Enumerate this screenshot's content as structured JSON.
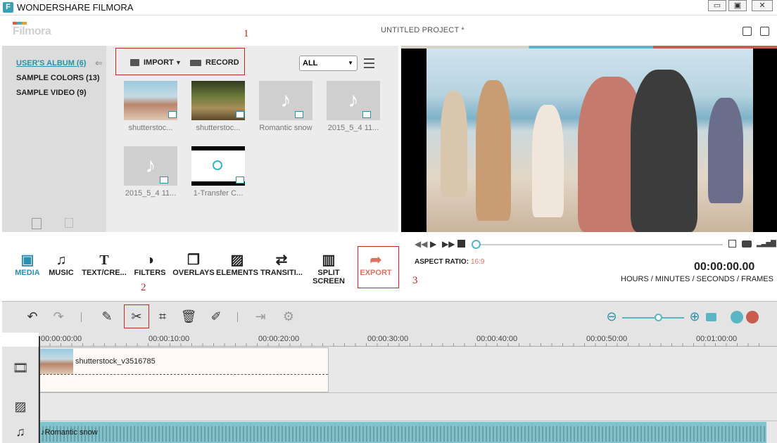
{
  "window": {
    "title": "WONDERSHARE FILMORA",
    "app_icon": "F",
    "minimize": "▭",
    "maximize": "▣",
    "close": "✕"
  },
  "header": {
    "logo": "Filmora",
    "project_title": "UNTITLED PROJECT *"
  },
  "annotations": {
    "one": "1",
    "two": "2",
    "three": "3"
  },
  "library": {
    "albums": [
      "USER'S ALBUM (6)",
      "SAMPLE COLORS (13)",
      "SAMPLE VIDEO (9)"
    ],
    "import_label": "IMPORT",
    "record_label": "RECORD",
    "filter_value": "ALL",
    "items": [
      {
        "label": "shutterstoc..."
      },
      {
        "label": "shutterstoc..."
      },
      {
        "label": "Romantic snow"
      },
      {
        "label": "2015_5_4 11..."
      },
      {
        "label": "2015_5_4 11..."
      },
      {
        "label": "1-Transfer C..."
      }
    ]
  },
  "tools": {
    "media": "MEDIA",
    "music": "MUSIC",
    "text": "TEXT/CRE...",
    "filters": "FILTERS",
    "overlays": "OVERLAYS",
    "elements": "ELEMENTS",
    "transitions": "TRANSITI...",
    "split_screen": "SPLIT SCREEN",
    "export": "EXPORT"
  },
  "player": {
    "aspect_label": "ASPECT RATIO:",
    "aspect_value": "16:9",
    "timecode": "00:00:00.00",
    "timecode_label": "HOURS / MINUTES / SECONDS / FRAMES"
  },
  "ruler": [
    "00:00:00:00",
    "00:00:10:00",
    "00:00:20:00",
    "00:00:30:00",
    "00:00:40:00",
    "00:00:50:00",
    "00:01:00:00"
  ],
  "timeline": {
    "video_clip": "shutterstock_v3516785",
    "audio_clip": "Romantic snow"
  },
  "colors": {
    "accent": "#2a8fb0",
    "annotation": "#c4281f",
    "export": "#e0705f",
    "audio": "#7fc4cc"
  }
}
